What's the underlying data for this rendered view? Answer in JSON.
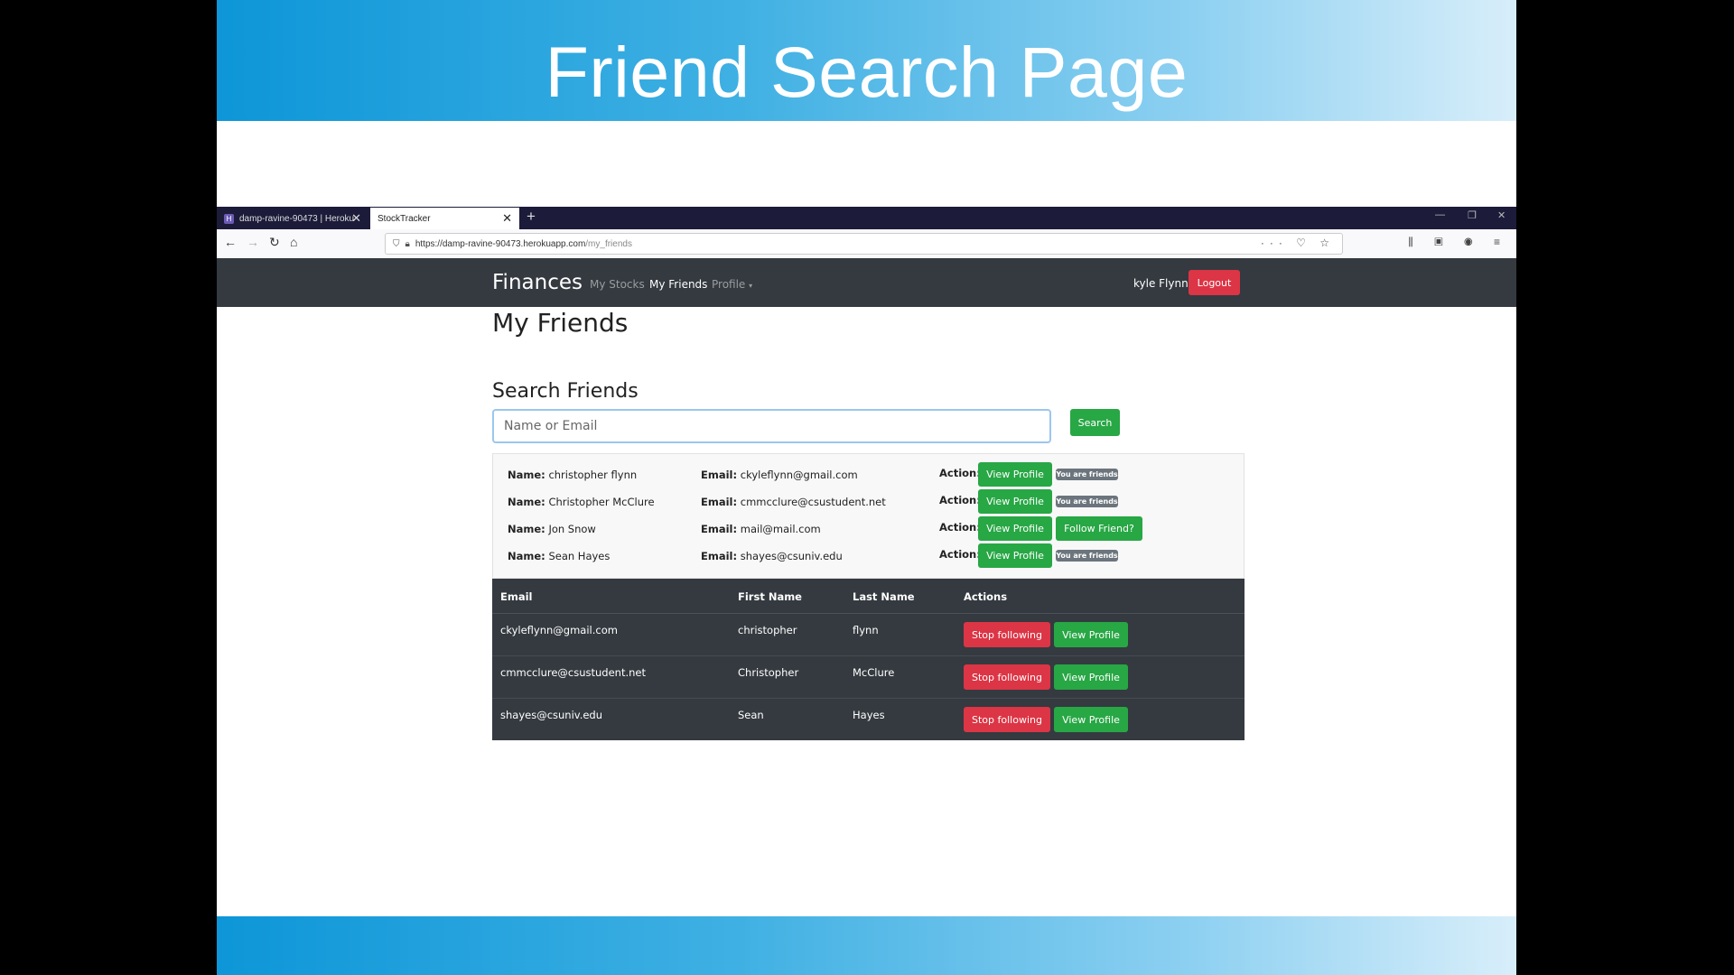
{
  "slide": {
    "title": "Friend Search Page"
  },
  "browser": {
    "tabs": [
      {
        "label": "damp-ravine-90473 | Heroku",
        "favicon": "H"
      },
      {
        "label": "StockTracker"
      }
    ],
    "url_base": "https://damp-ravine-90473.herokuapp.com",
    "url_path": "/my_friends"
  },
  "nav": {
    "brand": "Finances",
    "links": [
      "My Stocks",
      "My Friends",
      "Profile"
    ],
    "user": "kyle Flynn",
    "logout": "Logout"
  },
  "page": {
    "title": "My Friends",
    "search_title": "Search Friends",
    "search_placeholder": "Name or Email",
    "search_button": "Search"
  },
  "results": {
    "name_label": "Name:",
    "email_label": "Email:",
    "action_label": "Action:",
    "view_label": "View Profile",
    "rows": [
      {
        "name": "christopher flynn",
        "email": "ckyleflynn@gmail.com",
        "status": "You are friends"
      },
      {
        "name": "Christopher McClure",
        "email": "cmmcclure@csustudent.net",
        "status": "You are friends"
      },
      {
        "name": "Jon Snow",
        "email": "mail@mail.com",
        "follow": "Follow Friend?"
      },
      {
        "name": "Sean Hayes",
        "email": "shayes@csuniv.edu",
        "status": "You are friends"
      }
    ]
  },
  "friends_table": {
    "headers": [
      "Email",
      "First Name",
      "Last Name",
      "Actions"
    ],
    "stop_label": "Stop following",
    "view_label": "View Profile",
    "rows": [
      {
        "email": "ckyleflynn@gmail.com",
        "first": "christopher",
        "last": "flynn"
      },
      {
        "email": "cmmcclure@csustudent.net",
        "first": "Christopher",
        "last": "McClure"
      },
      {
        "email": "shayes@csuniv.edu",
        "first": "Sean",
        "last": "Hayes"
      }
    ]
  },
  "colors": {
    "accent_green": "#28a745",
    "accent_red": "#dc3545",
    "navbar": "#343a40"
  }
}
